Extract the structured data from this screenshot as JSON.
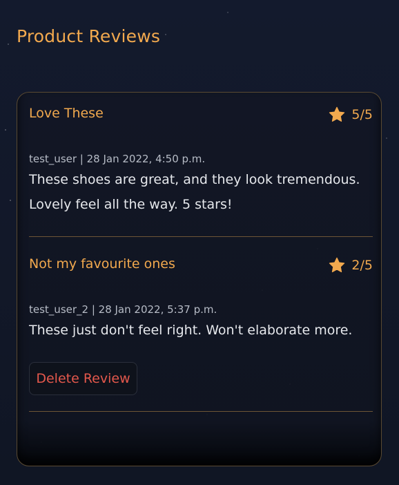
{
  "page": {
    "title": "Product Reviews"
  },
  "reviews": [
    {
      "title": "Love These",
      "rating": "5/5",
      "rating_value": 5,
      "rating_max": 5,
      "meta": "test_user | 28 Jan 2022, 4:50 p.m.",
      "body": "These shoes are great, and they look tremendous. Lovely feel all the way. 5 stars!"
    },
    {
      "title": "Not my favourite ones",
      "rating": "2/5",
      "rating_value": 2,
      "rating_max": 5,
      "meta": "test_user_2 | 28 Jan 2022, 5:37 p.m.",
      "body": "These just don't feel right. Won't elaborate more.",
      "delete_label": "Delete Review"
    }
  ],
  "icons": {
    "rating": "star-icon"
  },
  "colors": {
    "accent": "#f2a94e",
    "danger": "#e4584c",
    "text": "#e6e8ec",
    "meta": "#b7bcc6",
    "divider": "#6e5636"
  }
}
